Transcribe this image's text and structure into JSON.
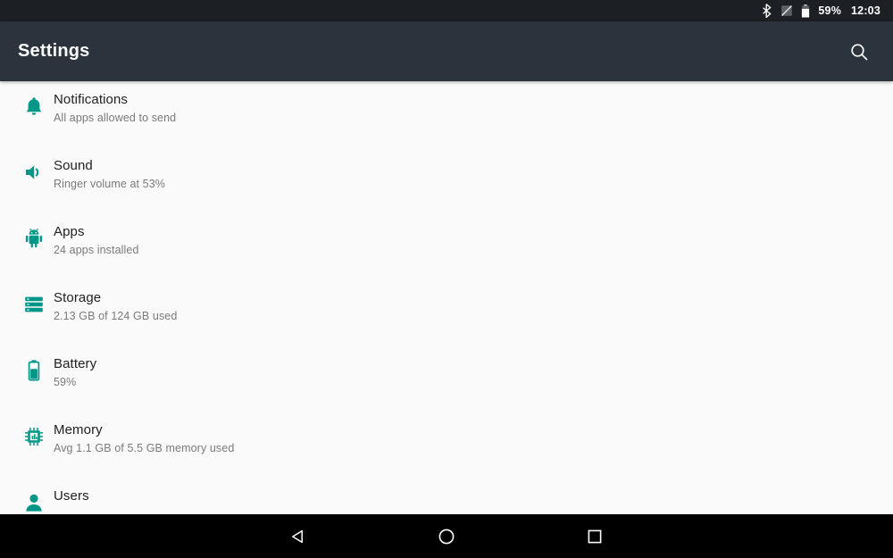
{
  "status_bar": {
    "bluetooth_icon": "bluetooth-icon",
    "signal_off_icon": "signal-no-sim-icon",
    "battery_icon": "battery-icon",
    "battery_percent": "59%",
    "time": "12:03"
  },
  "app_bar": {
    "title": "Settings",
    "search_icon": "search-icon"
  },
  "theme": {
    "status_bar_bg": "#1c1f23",
    "app_bar_bg": "#2b343c",
    "accent": "#009688",
    "content_bg": "#fafafa",
    "title_color": "#212121",
    "subtitle_color": "#7a7a7a",
    "nav_bar_bg": "#000000"
  },
  "settings": {
    "items": [
      {
        "icon": "bell-icon",
        "title": "Notifications",
        "subtitle": "All apps allowed to send"
      },
      {
        "icon": "volume-icon",
        "title": "Sound",
        "subtitle": "Ringer volume at 53%"
      },
      {
        "icon": "android-icon",
        "title": "Apps",
        "subtitle": "24 apps installed"
      },
      {
        "icon": "storage-icon",
        "title": "Storage",
        "subtitle": "2.13 GB of 124 GB used"
      },
      {
        "icon": "battery-icon",
        "title": "Battery",
        "subtitle": "59%"
      },
      {
        "icon": "memory-icon",
        "title": "Memory",
        "subtitle": "Avg 1.1 GB of 5.5 GB memory used"
      },
      {
        "icon": "person-icon",
        "title": "Users",
        "subtitle": ""
      }
    ]
  },
  "nav_bar": {
    "back_label": "back-button",
    "home_label": "home-button",
    "recents_label": "recents-button"
  }
}
